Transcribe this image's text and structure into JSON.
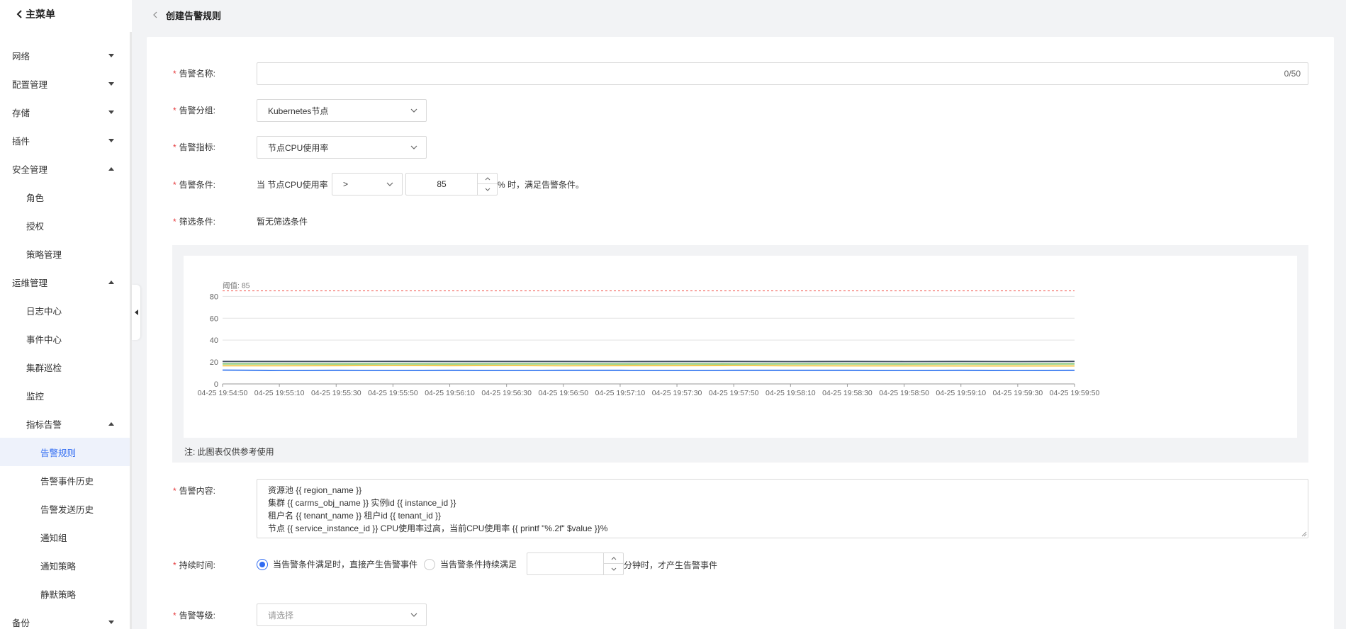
{
  "sidebar": {
    "main_menu": "主菜单",
    "items": [
      {
        "label": "网络",
        "level": 1,
        "caret": "down"
      },
      {
        "label": "配置管理",
        "level": 1,
        "caret": "down"
      },
      {
        "label": "存储",
        "level": 1,
        "caret": "down"
      },
      {
        "label": "插件",
        "level": 1,
        "caret": "down"
      },
      {
        "label": "安全管理",
        "level": 1,
        "caret": "up"
      },
      {
        "label": "角色",
        "level": 2
      },
      {
        "label": "授权",
        "level": 2
      },
      {
        "label": "策略管理",
        "level": 2
      },
      {
        "label": "运维管理",
        "level": 1,
        "caret": "up"
      },
      {
        "label": "日志中心",
        "level": 2
      },
      {
        "label": "事件中心",
        "level": 2
      },
      {
        "label": "集群巡检",
        "level": 2
      },
      {
        "label": "监控",
        "level": 2
      },
      {
        "label": "指标告警",
        "level": 2,
        "caret": "up"
      },
      {
        "label": "告警规则",
        "level": 3,
        "active": true
      },
      {
        "label": "告警事件历史",
        "level": 3
      },
      {
        "label": "告警发送历史",
        "level": 3
      },
      {
        "label": "通知组",
        "level": 3
      },
      {
        "label": "通知策略",
        "level": 3
      },
      {
        "label": "静默策略",
        "level": 3
      },
      {
        "label": "备份",
        "level": 1,
        "caret": "down"
      }
    ]
  },
  "header": {
    "title": "创建告警规则"
  },
  "form": {
    "name": {
      "label": "告警名称:",
      "value": "",
      "counter": "0/50"
    },
    "group": {
      "label": "告警分组:",
      "value": "Kubernetes节点"
    },
    "metric": {
      "label": "告警指标:",
      "value": "节点CPU使用率"
    },
    "condition": {
      "label": "告警条件:",
      "prefix": "当 节点CPU使用率",
      "operator": ">",
      "threshold": "85",
      "suffix": "% 时，满足告警条件。"
    },
    "filter": {
      "label": "筛选条件:",
      "value": "暂无筛选条件"
    },
    "content": {
      "label": "告警内容:",
      "lines": [
        "资源池 {{ region_name }}",
        "集群 {{ carms_obj_name }} 实例id {{ instance_id }}",
        "租户名 {{ tenant_name }} 租户id {{ tenant_id }}",
        "节点 {{ service_instance_id }} CPU使用率过高，当前CPU使用率 {{ printf \"%.2f\" $value }}%"
      ]
    },
    "duration": {
      "label": "持续时间:",
      "option_immediate": "当告警条件满足时，直接产生告警事件",
      "option_sustained": "当告警条件持续满足",
      "minutes_value": "",
      "suffix": "分钟时，才产生告警事件"
    },
    "level": {
      "label": "告警等级:",
      "placeholder": "请选择"
    }
  },
  "chart_note": "注: 此图表仅供参考使用",
  "chart_data": {
    "type": "line",
    "x": [
      "04-25 19:54:50",
      "04-25 19:55:10",
      "04-25 19:55:30",
      "04-25 19:55:50",
      "04-25 19:56:10",
      "04-25 19:56:30",
      "04-25 19:56:50",
      "04-25 19:57:10",
      "04-25 19:57:30",
      "04-25 19:57:50",
      "04-25 19:58:10",
      "04-25 19:58:30",
      "04-25 19:58:50",
      "04-25 19:59:10",
      "04-25 19:59:30",
      "04-25 19:59:50"
    ],
    "yticks": [
      0,
      20,
      40,
      60,
      80
    ],
    "ylim": [
      0,
      88
    ],
    "threshold": {
      "label": "阈值: 85",
      "value": 85,
      "color": "#f25c54"
    },
    "series": [
      {
        "color": "#3c4a5e",
        "values": [
          20.5,
          20.5,
          20.5,
          20.6,
          20.5,
          20.5,
          20.5,
          20.4,
          20.5,
          20.5,
          20.4,
          20.5,
          20.4,
          20.5,
          20.4,
          20.6
        ]
      },
      {
        "color": "#7cc36b",
        "values": [
          18.3,
          18.3,
          18.2,
          18.3,
          18.2,
          18.3,
          18.3,
          18.2,
          18.3,
          18.2,
          18.3,
          18.3,
          18.2,
          18.3,
          18.2,
          18.3
        ]
      },
      {
        "color": "#f3c33c",
        "values": [
          16.6,
          16.6,
          16.7,
          16.8,
          16.7,
          16.8,
          16.6,
          16.7,
          16.7,
          16.8,
          16.6,
          16.5,
          16.5,
          16.4,
          16.4,
          16.4
        ]
      },
      {
        "color": "#3a7bf0",
        "values": [
          12.6,
          12.3,
          12.4,
          12.3,
          12.4,
          12.3,
          12.4,
          12.4,
          12.3,
          12.4,
          12.4,
          12.4,
          12.3,
          12.4,
          12.3,
          12.4
        ]
      }
    ],
    "grid": true
  }
}
